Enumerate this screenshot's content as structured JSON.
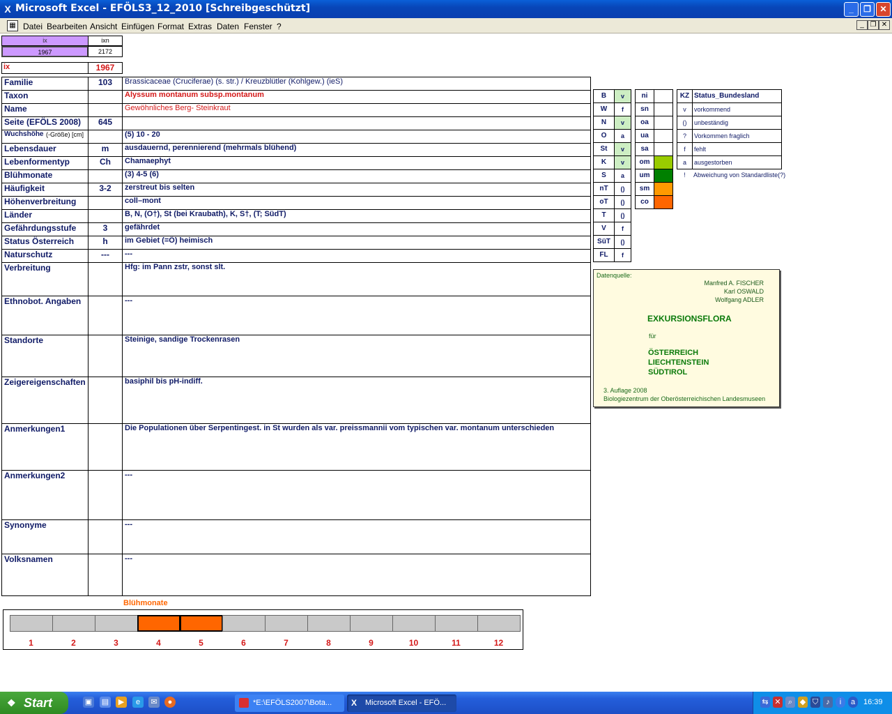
{
  "window": {
    "title": "Microsoft Excel - EFÖLS3_12_2010  [Schreibgeschützt]",
    "minimize": "_",
    "maximize": "❐",
    "close": "✕"
  },
  "menu": {
    "items": [
      "Datei",
      "Bearbeiten",
      "Ansicht",
      "Einfügen",
      "Format",
      "Extras",
      "Daten",
      "Fenster",
      "?"
    ]
  },
  "top": {
    "ix_header": "ix",
    "ixn_header": "ixn",
    "ix_value": "1967",
    "ixn_value": "2172",
    "ix_label": "ix",
    "ix_big": "1967"
  },
  "fields": [
    {
      "label": "Familie",
      "code": "103",
      "value": "Brassicaceae (Cruciferae) (s. str.)  /  Kreuzblütler (Kohlgew.) (ieS)"
    },
    {
      "label": "Taxon",
      "code": "",
      "value": "Alyssum montanum subsp.montanum"
    },
    {
      "label": "Name",
      "code": "",
      "value": "Gewöhnliches Berg- Steinkraut"
    },
    {
      "label": "Seite (EFÖLS 2008)",
      "code": "645",
      "value": ""
    },
    {
      "label": "Wuchshöhe",
      "label_small": "(-Größe) [cm]",
      "code": "",
      "value": "(5) 10 - 20"
    },
    {
      "label": "Lebensdauer",
      "code": "m",
      "value": "ausdauernd, perennierend (mehrmals blühend)"
    },
    {
      "label": "Lebenformentyp",
      "code": "Ch",
      "value": "Chamaephyt"
    },
    {
      "label": "Blühmonate",
      "code": "",
      "value": "(3) 4-5 (6)"
    },
    {
      "label": "Häufigkeit",
      "code": "3-2",
      "value": "zerstreut bis selten"
    },
    {
      "label": "Höhenverbreitung",
      "code": "",
      "value": "coll–mont"
    },
    {
      "label": "Länder",
      "code": "",
      "value": "B, N, (O†), St (bei Kraubath), K, S†, (T; SüdT)"
    },
    {
      "label": "Gefährdungsstufe",
      "code": "3",
      "value": "gefährdet"
    },
    {
      "label": "Status Österreich",
      "code": "h",
      "value": "im Gebiet (=Ö) heimisch"
    },
    {
      "label": "Naturschutz",
      "code": "---",
      "value": "---"
    },
    {
      "label": "Verbreitung",
      "code": "",
      "value": "Hfg: im Pann zstr, sonst slt."
    },
    {
      "label": "Ethnobot. Angaben",
      "code": "",
      "value": "---"
    },
    {
      "label": "Standorte",
      "code": "",
      "value": "Steinige, sandige Trockenrasen"
    },
    {
      "label": "Zeigereigenschaften",
      "code": "",
      "value": "basiphil bis pH-indiff."
    },
    {
      "label": "Anmerkungen1",
      "code": "",
      "value": "Die Populationen über Serpentingest. in St wurden als var. preissmannii  vom typischen var. montanum unterschieden"
    },
    {
      "label": "Anmerkungen2",
      "code": "",
      "value": "---"
    },
    {
      "label": "Synonyme",
      "code": "",
      "value": "---"
    },
    {
      "label": "Volksnamen",
      "code": "",
      "value": "---"
    }
  ],
  "states": [
    {
      "code": "B",
      "status": "v"
    },
    {
      "code": "W",
      "status": "f"
    },
    {
      "code": "N",
      "status": "v"
    },
    {
      "code": "O",
      "status": "a"
    },
    {
      "code": "St",
      "status": "v"
    },
    {
      "code": "K",
      "status": "v"
    },
    {
      "code": "S",
      "status": "a"
    },
    {
      "code": "nT",
      "status": "()"
    },
    {
      "code": "oT",
      "status": "()"
    },
    {
      "code": "T",
      "status": "()"
    },
    {
      "code": "V",
      "status": "f"
    },
    {
      "code": "SüT",
      "status": "()"
    },
    {
      "code": "FL",
      "status": "f"
    }
  ],
  "zones": [
    {
      "code": "ni",
      "color": ""
    },
    {
      "code": "sn",
      "color": ""
    },
    {
      "code": "oa",
      "color": ""
    },
    {
      "code": "ua",
      "color": ""
    },
    {
      "code": "sa",
      "color": ""
    },
    {
      "code": "om",
      "color": "#99cc00"
    },
    {
      "code": "um",
      "color": "#008000"
    },
    {
      "code": "sm",
      "color": "#ff9900"
    },
    {
      "code": "co",
      "color": "#ff6600"
    }
  ],
  "legend": {
    "header_kz": "KZ",
    "header_status": "Status_Bundesland",
    "rows": [
      {
        "kz": "v",
        "text": "vorkommend"
      },
      {
        "kz": "()",
        "text": "unbeständig"
      },
      {
        "kz": "?",
        "text": "Vorkommen fraglich"
      },
      {
        "kz": "f",
        "text": "fehlt"
      },
      {
        "kz": "a",
        "text": "ausgestorben"
      },
      {
        "kz": "!",
        "text": "Abweichung von Standardliste(?)"
      }
    ]
  },
  "source": {
    "label": "Datenquelle:",
    "authors": [
      "Manfred A. FISCHER",
      "Karl OSWALD",
      "Wolfgang ADLER"
    ],
    "title": "EXKURSIONSFLORA",
    "fuer": "für",
    "countries": [
      "ÖSTERREICH",
      "LIECHTENSTEIN",
      "SÜDTIROL"
    ],
    "edition": "3. Auflage 2008",
    "publisher": "Biologiezentrum der Oberösterreichischen Landesmuseen"
  },
  "bluehmonate": {
    "title": "Blühmonate",
    "months": [
      "1",
      "2",
      "3",
      "4",
      "5",
      "6",
      "7",
      "8",
      "9",
      "10",
      "11",
      "12"
    ],
    "flowering": [
      false,
      false,
      false,
      true,
      true,
      false,
      false,
      false,
      false,
      false,
      false,
      false
    ]
  },
  "taskbar": {
    "start": "Start",
    "tasks": [
      "*E:\\EFÖLS2007\\Bota...",
      "Microsoft Excel - EFÖ..."
    ],
    "clock": "16:39"
  }
}
